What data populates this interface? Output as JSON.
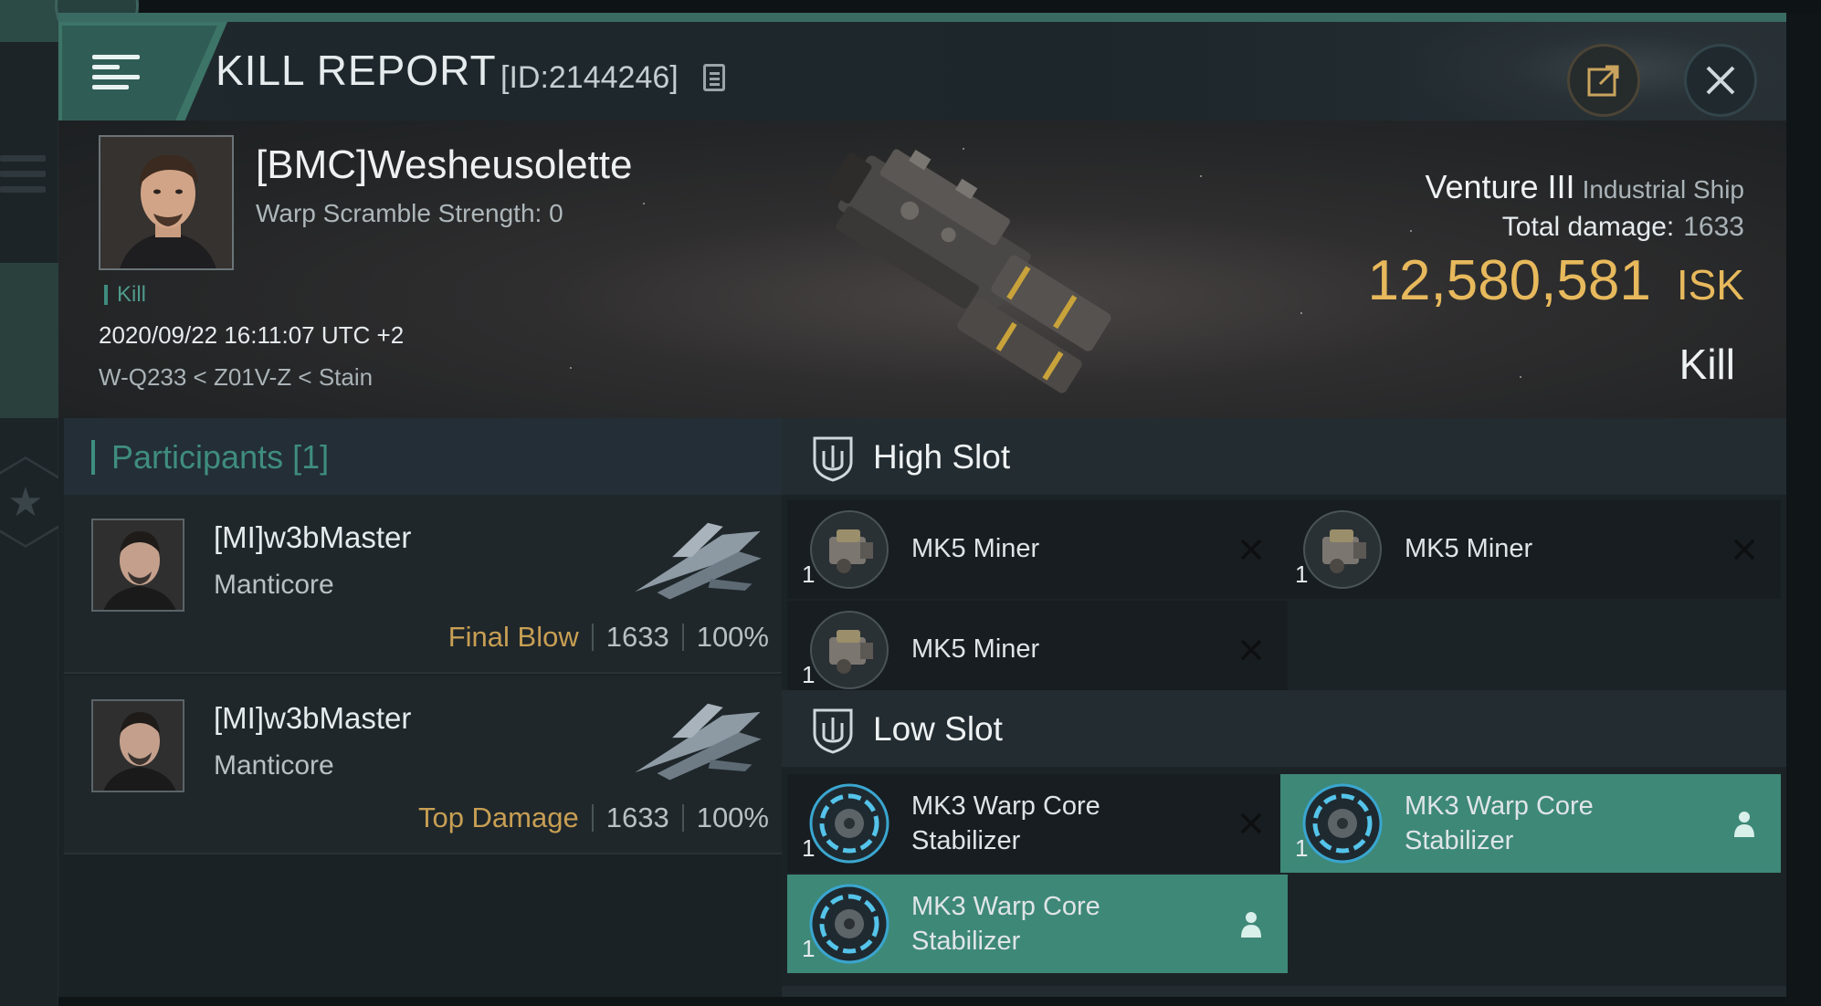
{
  "window": {
    "title": "KILL REPORT",
    "id_label": "[ID:2144246]"
  },
  "victim": {
    "name": "[BMC]Wesheusolette",
    "warp_scramble": "Warp Scramble Strength: 0",
    "kill_tag": "Kill",
    "datetime": "2020/09/22 16:11:07 UTC +2",
    "location": "W-Q233 < Z01V-Z < Stain",
    "ship_name": "Venture III",
    "ship_class": "Industrial Ship",
    "total_damage_label": "Total damage:",
    "total_damage": "1633",
    "isk_value": "12,580,581",
    "isk_unit": "ISK",
    "result": "Kill"
  },
  "participants": {
    "title": "Participants [1]",
    "rows": [
      {
        "name": "[MI]w3bMaster",
        "ship": "Manticore",
        "role": "Final Blow",
        "damage": "1633",
        "percent": "100%"
      },
      {
        "name": "[MI]w3bMaster",
        "ship": "Manticore",
        "role": "Top Damage",
        "damage": "1633",
        "percent": "100%"
      }
    ]
  },
  "slots": {
    "high": {
      "title": "High Slot",
      "modules": [
        {
          "name": "MK5 Miner",
          "qty": "1",
          "state": "destroyed"
        },
        {
          "name": "MK5 Miner",
          "qty": "1",
          "state": "destroyed"
        },
        {
          "name": "MK5 Miner",
          "qty": "1",
          "state": "destroyed"
        }
      ]
    },
    "low": {
      "title": "Low Slot",
      "modules": [
        {
          "name_line1": "MK3 Warp Core",
          "name_line2": "Stabilizer",
          "qty": "1",
          "state": "destroyed"
        },
        {
          "name_line1": "MK3 Warp Core",
          "name_line2": "Stabilizer",
          "qty": "1",
          "state": "dropped"
        },
        {
          "name_line1": "MK3 Warp Core",
          "name_line2": "Stabilizer",
          "qty": "1",
          "state": "dropped"
        }
      ]
    }
  },
  "colors": {
    "accent": "#3e8878",
    "isk": "#e7b95c",
    "final_blow": "#c89f53"
  },
  "icons": {
    "menu": "hamburger-icon",
    "copy": "copy-icon",
    "share": "share-icon",
    "close": "close-icon",
    "slot": "slot-shield-icon",
    "destroyed": "x-icon",
    "dropped": "person-icon"
  }
}
